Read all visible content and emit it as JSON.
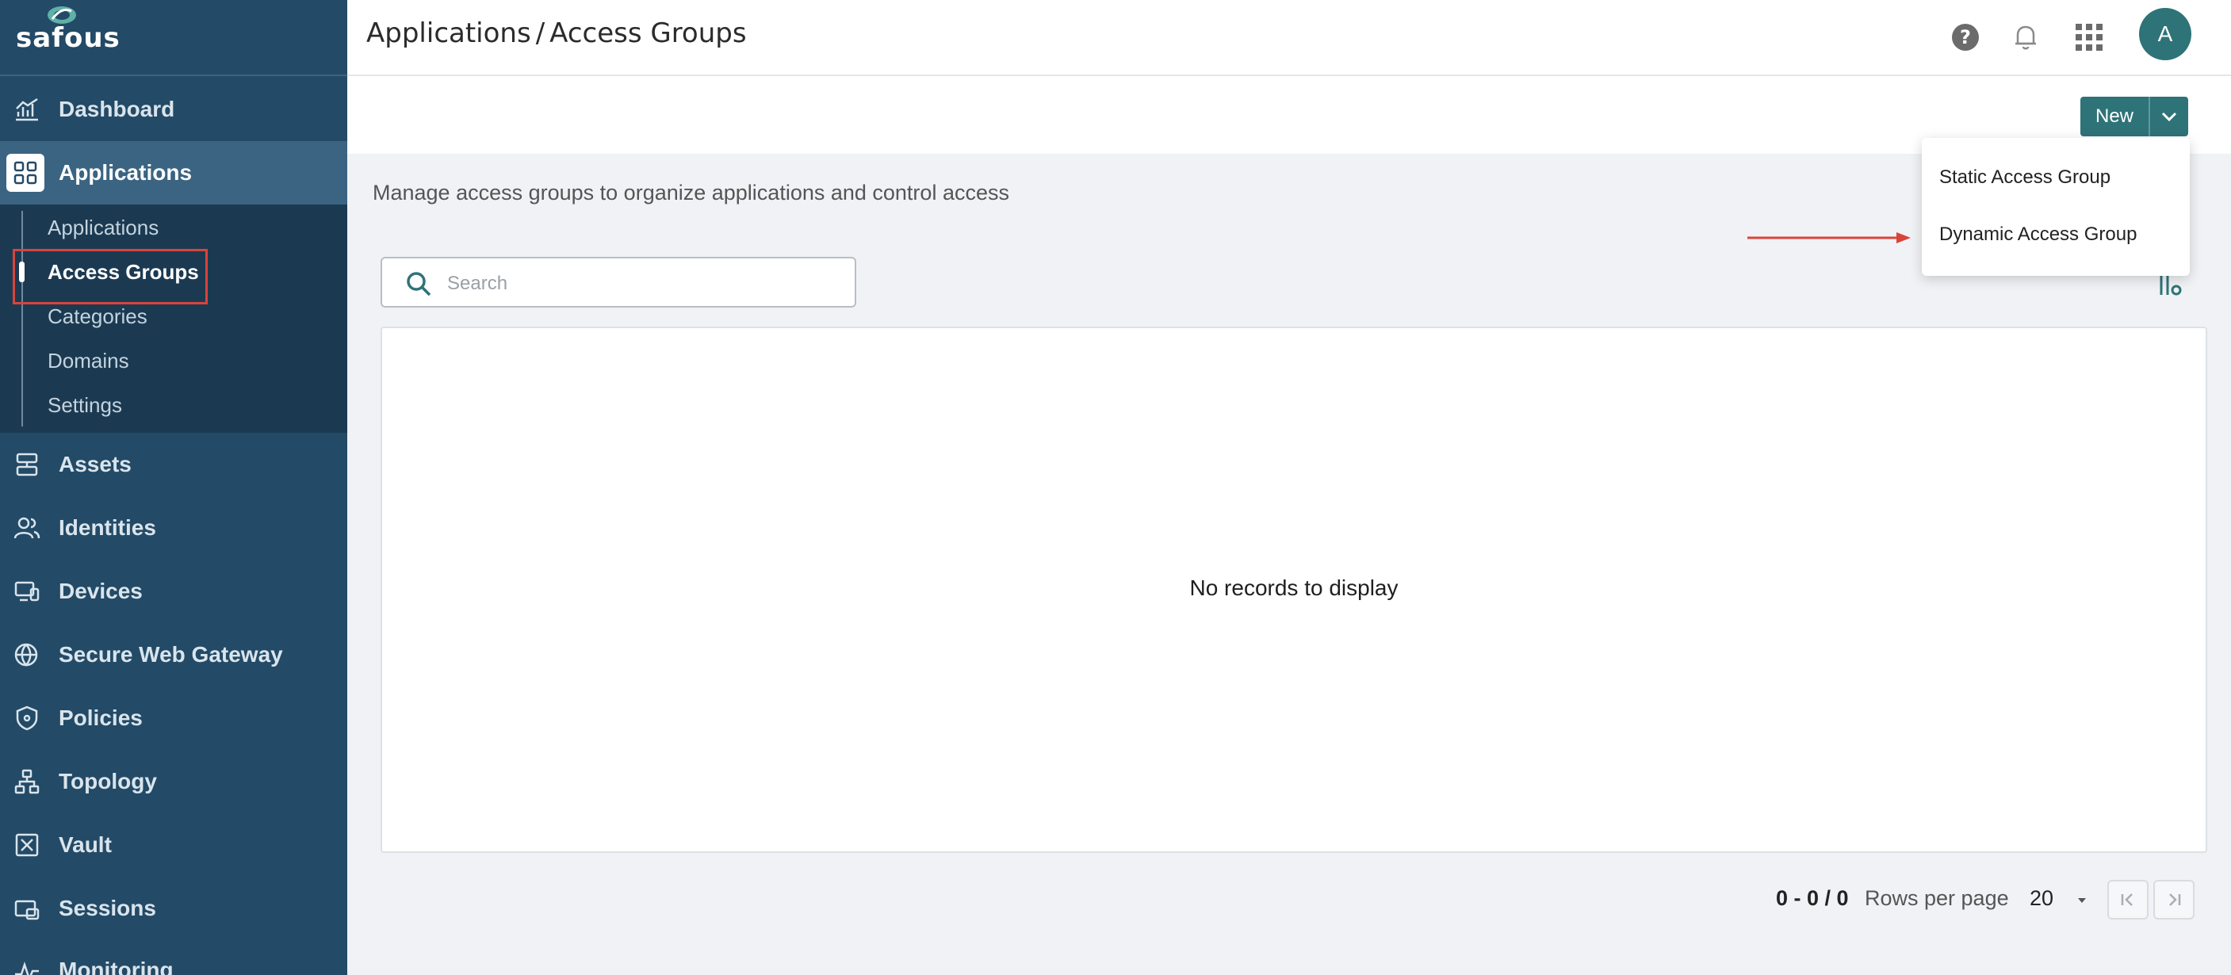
{
  "brand": {
    "name": "safous",
    "accent": "#2e7378",
    "sidebar_bg": "#234a66",
    "highlight": "#d9443a"
  },
  "sidebar": {
    "items": [
      {
        "label": "Dashboard",
        "icon": "chart-icon"
      },
      {
        "label": "Applications",
        "icon": "grid-icon",
        "active": true
      },
      {
        "label": "Assets",
        "icon": "server-icon"
      },
      {
        "label": "Identities",
        "icon": "users-icon"
      },
      {
        "label": "Devices",
        "icon": "devices-icon"
      },
      {
        "label": "Secure Web Gateway",
        "icon": "globe-icon"
      },
      {
        "label": "Policies",
        "icon": "shield-icon"
      },
      {
        "label": "Topology",
        "icon": "topology-icon"
      },
      {
        "label": "Vault",
        "icon": "vault-icon"
      },
      {
        "label": "Sessions",
        "icon": "sessions-icon"
      },
      {
        "label": "Monitoring",
        "icon": "pulse-icon"
      }
    ],
    "subitems": [
      {
        "label": "Applications"
      },
      {
        "label": "Access Groups",
        "active": true
      },
      {
        "label": "Categories"
      },
      {
        "label": "Domains"
      },
      {
        "label": "Settings"
      }
    ]
  },
  "header": {
    "breadcrumb_parent": "Applications",
    "breadcrumb_sep": "/",
    "breadcrumb_current": "Access Groups",
    "avatar_initial": "A"
  },
  "toolbar": {
    "new_label": "New"
  },
  "dropdown": {
    "options": [
      "Static Access Group",
      "Dynamic Access Group"
    ]
  },
  "main": {
    "description": "Manage access groups to organize applications and control access",
    "search_placeholder": "Search",
    "empty_message": "No records to display"
  },
  "pagination": {
    "range": "0 - 0 / 0",
    "rows_label": "Rows per page",
    "rows_value": "20"
  }
}
